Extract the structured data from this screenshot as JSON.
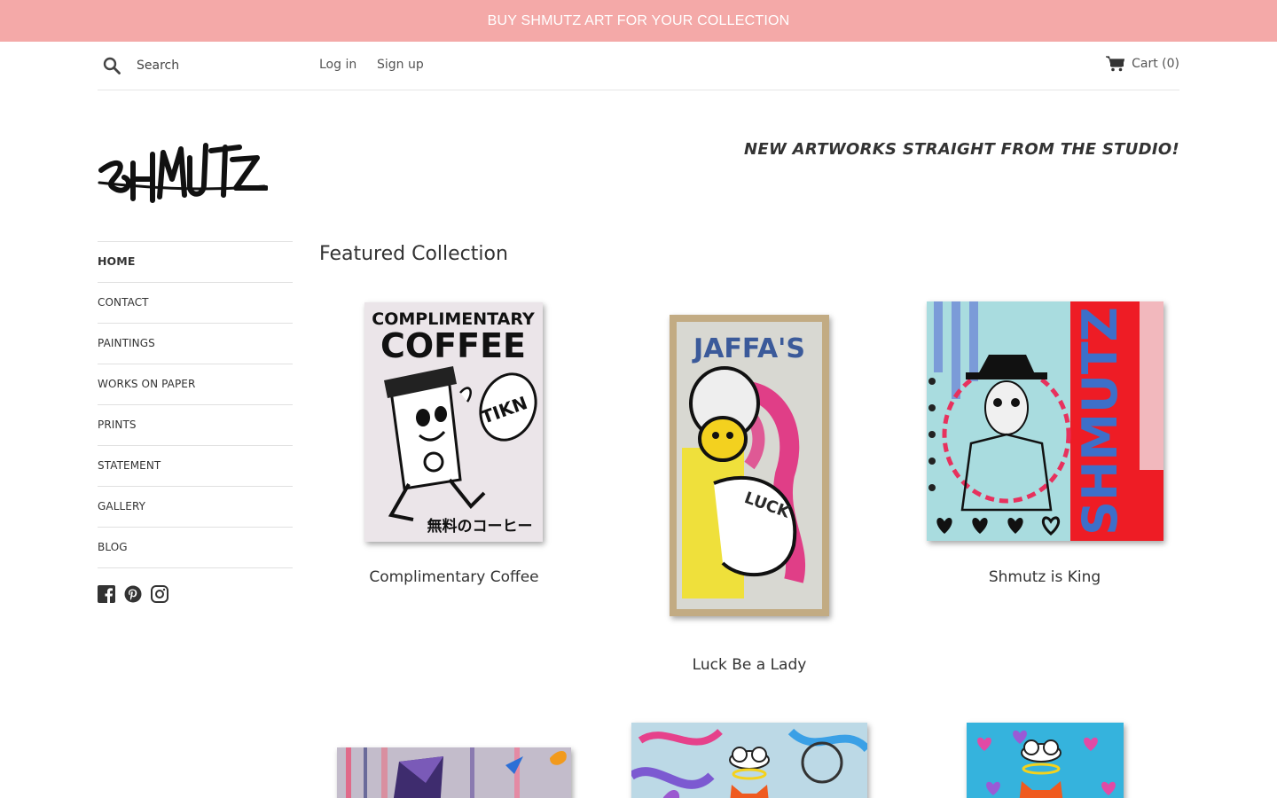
{
  "announcement": "BUY SHMUTZ ART FOR YOUR COLLECTION",
  "header": {
    "search_placeholder": "Search",
    "login_label": "Log in",
    "signup_label": "Sign up",
    "cart_label": "Cart (0)"
  },
  "brand": {
    "tagline": "NEW ARTWORKS STRAIGHT FROM THE STUDIO!",
    "logo_text": "SHMUTZ"
  },
  "nav": {
    "items": [
      {
        "label": "HOME",
        "active": true
      },
      {
        "label": "CONTACT"
      },
      {
        "label": "PAINTINGS"
      },
      {
        "label": "WORKS ON PAPER"
      },
      {
        "label": "PRINTS"
      },
      {
        "label": "STATEMENT"
      },
      {
        "label": "GALLERY"
      },
      {
        "label": "BLOG"
      }
    ],
    "social": [
      "facebook-icon",
      "pinterest-icon",
      "instagram-icon"
    ]
  },
  "collection": {
    "title": "Featured Collection",
    "products": [
      {
        "title": "Complimentary Coffee",
        "art_text_top": "COMPLIMENTARY",
        "art_text_big": "COFFEE",
        "art_text_bubble": "TIKN",
        "art_text_bottom": "無料のコーヒー"
      },
      {
        "title": "Luck Be a Lady",
        "art_text_top": "JAFFA'S",
        "art_text_mid": "LUCK"
      },
      {
        "title": "Shmutz is King",
        "art_text_side": "SHMUTZ"
      }
    ]
  },
  "colors": {
    "announcement_bg": "#f4a9a8",
    "text": "#333333"
  }
}
